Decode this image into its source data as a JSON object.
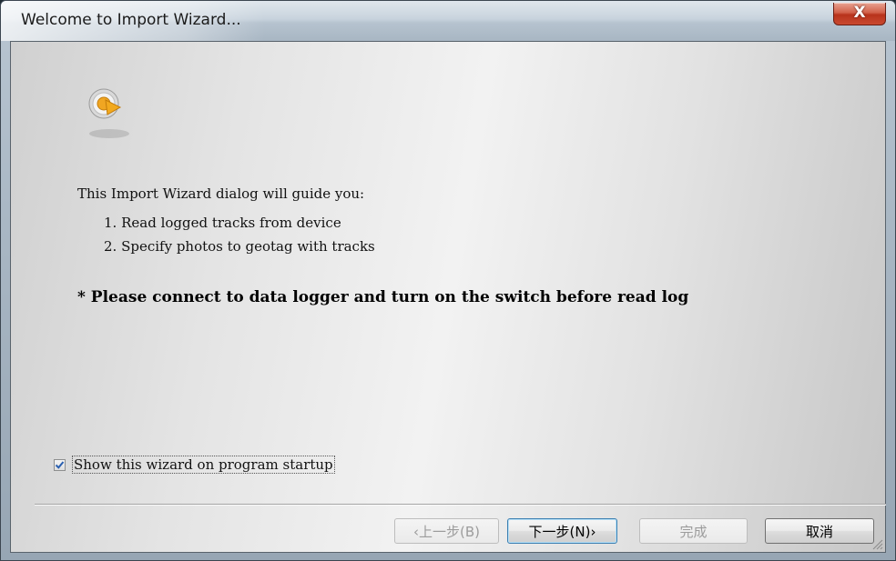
{
  "window": {
    "title": "Welcome to Import Wizard...",
    "close_label": "X"
  },
  "content": {
    "app_icon": "import-wizard-icon",
    "intro": "This Import Wizard dialog will guide you:",
    "steps": [
      "1. Read logged tracks from device",
      "2. Specify photos to geotag with tracks"
    ],
    "notice": "* Please connect to data logger and turn on the switch before read log",
    "show_on_startup": {
      "label": "Show this wizard on program startup",
      "checked": true
    }
  },
  "buttons": {
    "back": "‹上一步(B)",
    "next": "下一步(N)›",
    "finish": "完成",
    "cancel": "取消"
  },
  "colors": {
    "close_button": "#c9492f",
    "icon_orange": "#f0a622"
  }
}
